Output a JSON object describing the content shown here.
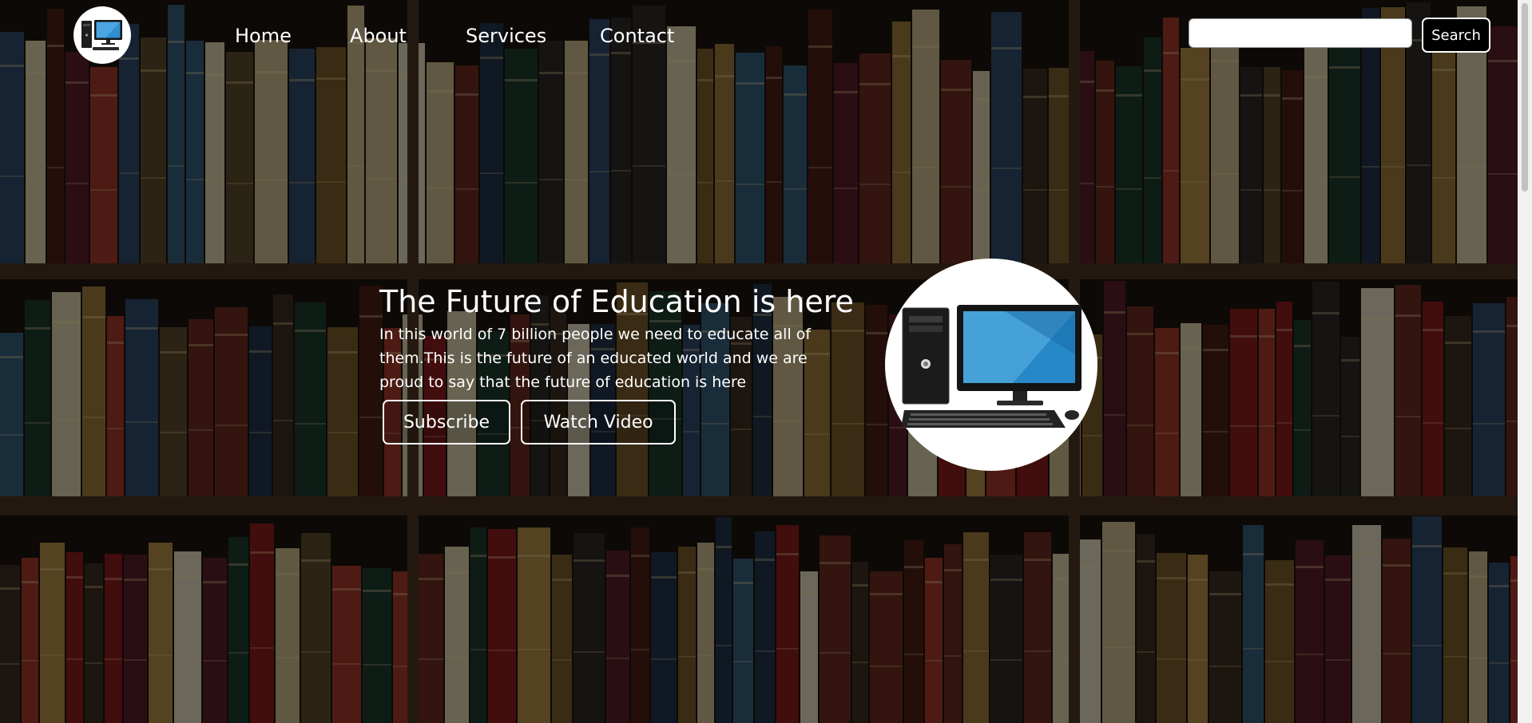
{
  "nav": {
    "logo_icon": "desktop-computer-icon",
    "links": [
      "Home",
      "About",
      "Services",
      "Contact"
    ],
    "search": {
      "value": "",
      "placeholder": "",
      "button_label": "Search"
    }
  },
  "hero": {
    "title": "The Future of Education is here",
    "text": "In this world of 7 billion people we need to educate all of them.This is the future of an educated world and we are proud to say that the future of education is here",
    "buttons": {
      "subscribe": "Subscribe",
      "watch_video": "Watch Video"
    },
    "image_icon": "desktop-computer-icon"
  },
  "colors": {
    "text": "#ffffff",
    "overlay": "#000000",
    "button_border": "#ffffff",
    "search_button_bg": "#000000"
  }
}
